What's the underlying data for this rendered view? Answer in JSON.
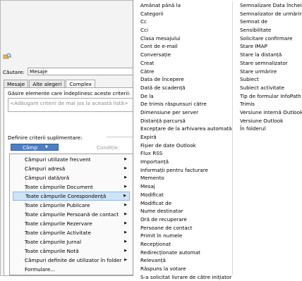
{
  "dialog": {
    "search_label": "Căutare:",
    "search_value": "Mesaje",
    "tabs": [
      "Mesaje",
      "Alte alegeri",
      "Complex"
    ],
    "criteria_heading": "Găsire elemente care îndeplinesc aceste criterii:",
    "criteria_placeholder": "<Adăugare criterii de mai jos la această listă>",
    "extra_criteria_heading": "Definire criterii suplimentare:",
    "field_button": "Câmp",
    "condition_label": "Condiție:"
  },
  "field_menu": {
    "items": [
      {
        "label": "Câmpuri utilizate frecvent",
        "submenu": true
      },
      {
        "label": "Câmpuri adresă",
        "submenu": true
      },
      {
        "label": "Câmpuri dată/oră",
        "submenu": true
      },
      {
        "label": "Toate câmpurile Document",
        "submenu": true
      },
      {
        "label": "Toate câmpurile Corespondență",
        "submenu": true,
        "selected": true
      },
      {
        "label": "Toate câmpurile Publicare",
        "submenu": true
      },
      {
        "label": "Toate câmpurile Persoană de contact",
        "submenu": true
      },
      {
        "label": "Toate câmpurile Rezervare",
        "submenu": true
      },
      {
        "label": "Toate câmpurile Activitate",
        "submenu": true
      },
      {
        "label": "Toate câmpurile Jurnal",
        "submenu": true
      },
      {
        "label": "Toate câmpurile Notă",
        "submenu": true
      },
      {
        "label": "Câmpuri definite de utilizator în folder",
        "submenu": true
      },
      {
        "label": "Formulare...",
        "submenu": false
      }
    ]
  },
  "mail_fields": {
    "column1": [
      "Amânat până la",
      "Categorii",
      "Cc",
      "Cci",
      "Clasa mesajului",
      "Cont de e-mail",
      "Conversație",
      "Creat",
      "Către",
      "Data de începere",
      "Dată de scadență",
      "De la",
      "De trimis răspunsuri către",
      "Dimensiune per server",
      "Distanță parcursă",
      "Excepțare de la arhivarea automată",
      "Expiră",
      "Fișier de date Outlook",
      "Flux RSS",
      "Importanță",
      "Informații pentru facturare",
      "Memento",
      "Mesaj",
      "Modificat",
      "Modificat de",
      "Nume destinatar",
      "Oră de recuperare",
      "Persoane de contact",
      "Primit în numele",
      "Recepționat",
      "Redirecționate automat",
      "Relevanță",
      "Răspuns la votare",
      "S-a solicitat livrare de către inițiator"
    ],
    "column2": [
      "Semnalizare Data încheierii",
      "Semnalizator de urmărire",
      "Semnat de",
      "Sensibilitate",
      "Solicitare confirmare",
      "Stare IMAP",
      "Stare la distanță",
      "Stare semnalizator",
      "Stare urmărire",
      "Subiect",
      "Subiect activitate",
      "Tip de formular InfoPath",
      "Trimis",
      "Versiune internă Outlook",
      "Versiune Outlook",
      "În folderul"
    ]
  }
}
